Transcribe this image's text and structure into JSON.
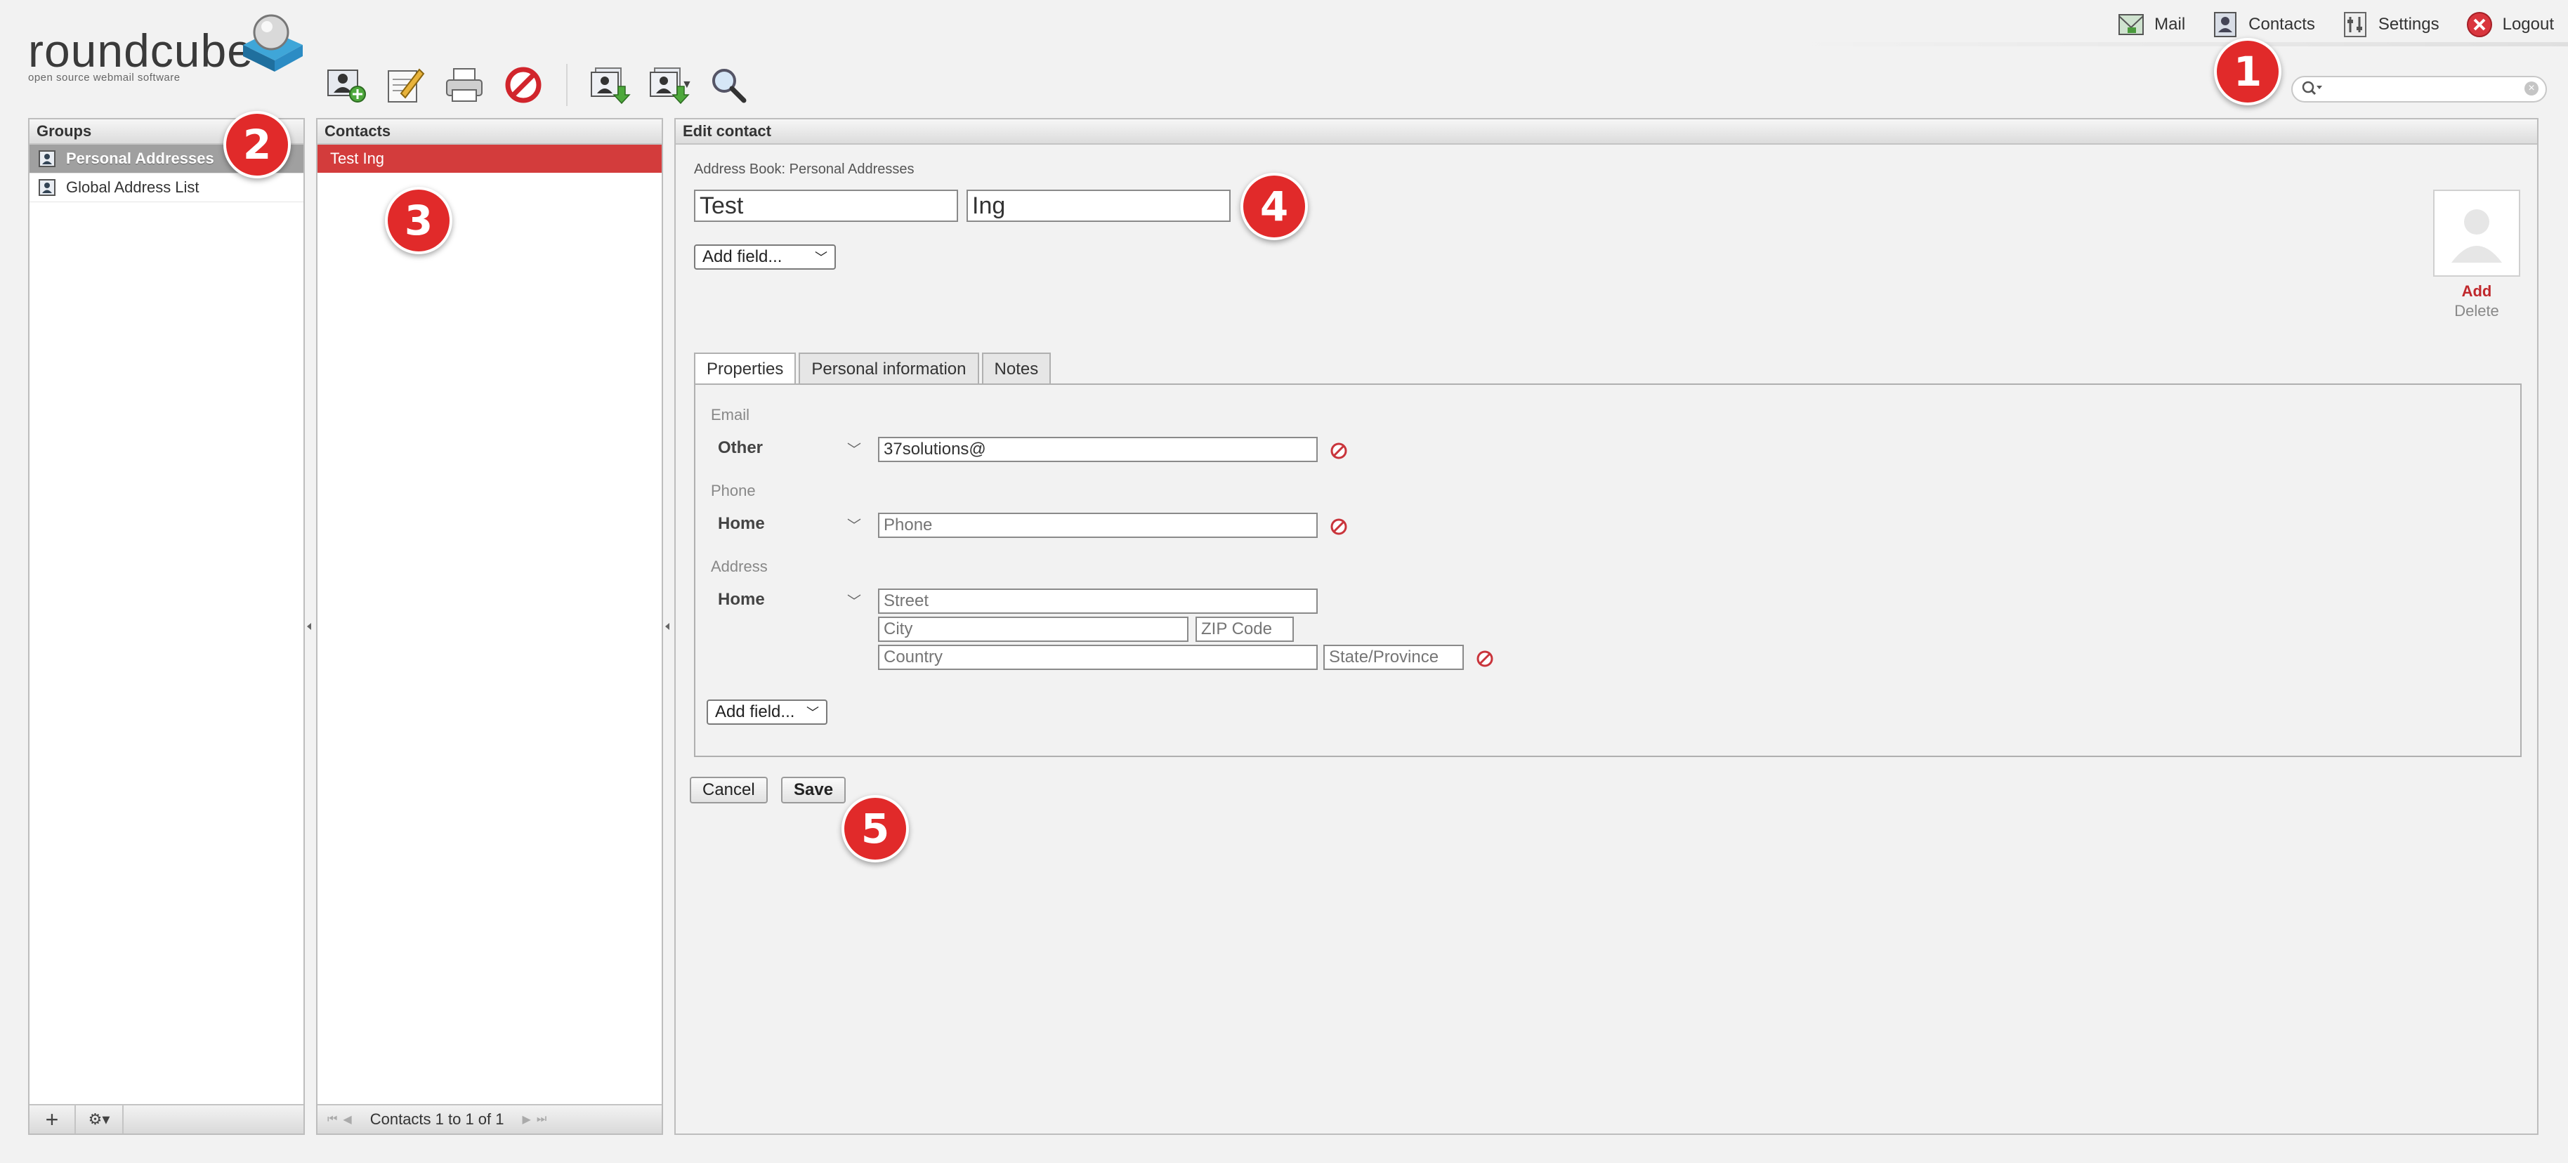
{
  "app": {
    "logo_text": "roundcube",
    "logo_tagline": "open source webmail software"
  },
  "topnav": [
    {
      "label": "Mail",
      "icon": "mail-icon"
    },
    {
      "label": "Contacts",
      "icon": "contacts-icon"
    },
    {
      "label": "Settings",
      "icon": "settings-icon"
    },
    {
      "label": "Logout",
      "icon": "logout-icon"
    }
  ],
  "toolbar": {
    "items": [
      "add-contact-icon",
      "compose-icon",
      "print-icon",
      "delete-icon",
      "import-icon",
      "export-icon",
      "search-icon"
    ]
  },
  "search": {
    "value": "",
    "placeholder": ""
  },
  "groups": {
    "title": "Groups",
    "items": [
      {
        "label": "Personal Addresses",
        "selected": true
      },
      {
        "label": "Global Address List",
        "selected": false
      }
    ],
    "footer": {
      "add_label": "+",
      "gear_label": "⚙▾"
    }
  },
  "contacts": {
    "title": "Contacts",
    "items": [
      {
        "label": "Test Ing",
        "selected": true
      }
    ],
    "pager_text": "Contacts 1 to 1 of 1"
  },
  "edit": {
    "title": "Edit contact",
    "address_book": "Address Book: Personal Addresses",
    "first_name": "Test",
    "last_name": "Ing",
    "add_field_label": "Add field...",
    "photo_add": "Add",
    "photo_delete": "Delete",
    "tabs": [
      "Properties",
      "Personal information",
      "Notes"
    ],
    "email": {
      "section": "Email",
      "type": "Other",
      "value": "37solutions@"
    },
    "phone": {
      "section": "Phone",
      "type": "Home",
      "placeholder": "Phone"
    },
    "address": {
      "section": "Address",
      "type": "Home",
      "street": "Street",
      "city": "City",
      "zip": "ZIP Code",
      "country": "Country",
      "state": "State/Province"
    },
    "add_field_label_2": "Add field...",
    "cancel_label": "Cancel",
    "save_label": "Save"
  },
  "markers": [
    "1",
    "2",
    "3",
    "4",
    "5"
  ],
  "colors": {
    "accent": "#d33c3c",
    "marker": "#e12a2a"
  }
}
